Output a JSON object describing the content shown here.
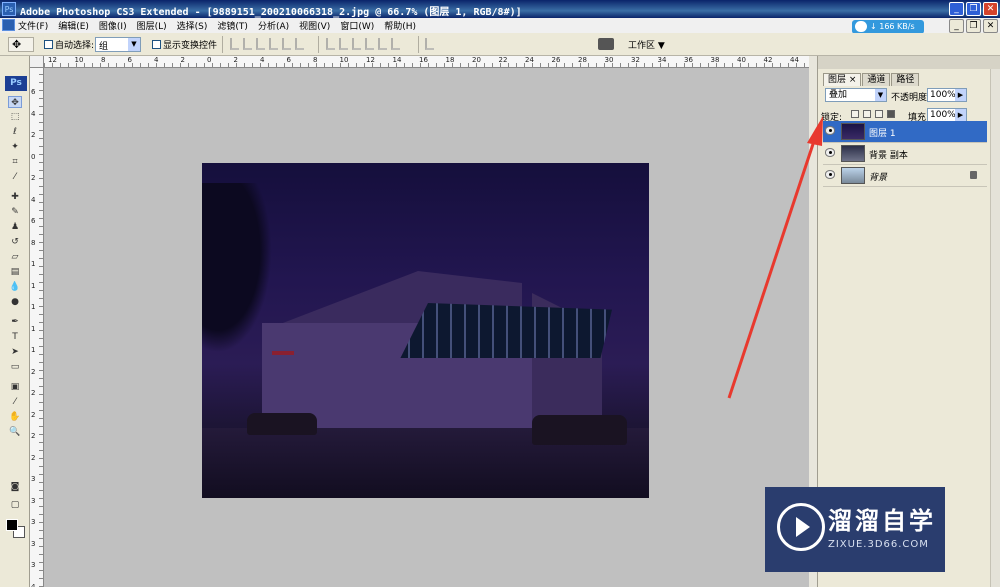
{
  "window": {
    "title": "Adobe Photoshop CS3 Extended - [9889151_200210066318_2.jpg @ 66.7% (图层 1, RGB/8#)]",
    "app_icon": "Ps",
    "buttons": [
      "_",
      "❐",
      "✕"
    ]
  },
  "menu": {
    "items": [
      "文件(F)",
      "编辑(E)",
      "图像(I)",
      "图层(L)",
      "选择(S)",
      "滤镜(T)",
      "分析(A)",
      "视图(V)",
      "窗口(W)",
      "帮助(H)"
    ]
  },
  "speed_badge": {
    "text": "↓ 166 KB/s"
  },
  "options_bar": {
    "auto_select_label": "自动选择:",
    "auto_select_value": "组",
    "show_transform_label": "显示变换控件",
    "workspace_label": "工作区 ▼"
  },
  "toolbox": {
    "logo": "Ps"
  },
  "rulers": {
    "top_labels": [
      "12",
      "10",
      "8",
      "6",
      "4",
      "2",
      "0",
      "2",
      "4",
      "6",
      "8",
      "10",
      "12",
      "14",
      "16",
      "18",
      "20",
      "22",
      "24",
      "26",
      "28",
      "30",
      "32",
      "34",
      "36",
      "38",
      "40",
      "42",
      "44"
    ],
    "left_labels": [
      "6",
      "4",
      "2",
      "0",
      "2",
      "4",
      "6",
      "8",
      "1",
      "1",
      "1",
      "1",
      "1",
      "2",
      "2",
      "2",
      "2",
      "2",
      "3",
      "3",
      "3",
      "3",
      "3",
      "4"
    ]
  },
  "layers_panel": {
    "tabs": [
      "图层 ×",
      "通道",
      "路径"
    ],
    "blend_mode": "叠加",
    "opacity_label": "不透明度:",
    "opacity_value": "100%",
    "lock_label": "锁定:",
    "fill_label": "填充:",
    "fill_value": "100%",
    "layers": [
      {
        "name": "图层 1",
        "selected": true
      },
      {
        "name": "背景 副本",
        "selected": false
      },
      {
        "name": "背景",
        "selected": false,
        "locked": true
      }
    ]
  },
  "watermark": {
    "title": "溜溜自学",
    "subtitle": "ZIXUE.3D66.COM"
  },
  "colors": {
    "selection": "#316ac5",
    "arrow": "#e8392e",
    "canvas_bg": "#c0c0c0"
  }
}
